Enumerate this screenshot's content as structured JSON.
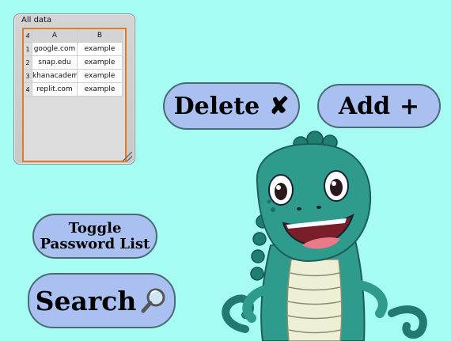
{
  "table_window": {
    "title": "All data",
    "row_count": "4",
    "columns": [
      "A",
      "B"
    ],
    "rows": [
      {
        "index": "1",
        "a": "google.com",
        "b": "example"
      },
      {
        "index": "2",
        "a": "snap.edu",
        "b": "example"
      },
      {
        "index": "3",
        "a": "khanacademy",
        "b": "example"
      },
      {
        "index": "4",
        "a": "replit.com",
        "b": "example"
      }
    ]
  },
  "buttons": {
    "delete_label": "Delete",
    "delete_glyph": "✘",
    "add_label": "Add",
    "add_glyph": "+",
    "toggle_line1": "Toggle",
    "toggle_line2": "Password List",
    "search_label": "Search"
  },
  "icons": {
    "delete": "cross-mark-icon",
    "add": "plus-icon",
    "search": "magnifier-icon"
  },
  "colors": {
    "background": "#a6fbf3",
    "button_fill": "#aac0f0",
    "button_border": "#4a6a74",
    "table_border": "#e07a2c",
    "mascot_body": "#2e9b8c"
  }
}
